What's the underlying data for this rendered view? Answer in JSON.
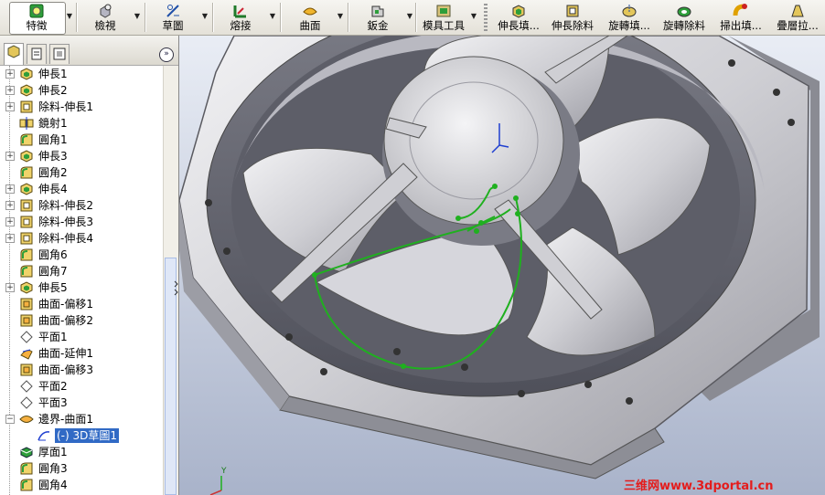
{
  "toolbar": {
    "items": [
      {
        "label": "特徵",
        "icon": "feature-icon"
      },
      {
        "label": "檢視",
        "icon": "view-icon"
      },
      {
        "label": "草圖",
        "icon": "sketch-icon"
      },
      {
        "label": "熔接",
        "icon": "weldment-icon"
      },
      {
        "label": "曲面",
        "icon": "surface-icon"
      },
      {
        "label": "鈑金",
        "icon": "sheet-metal-icon"
      },
      {
        "label": "模具工具",
        "icon": "mold-tools-icon"
      },
      {
        "label": "伸長填...",
        "icon": "extrude-boss-icon"
      },
      {
        "label": "伸長除料",
        "icon": "extrude-cut-icon"
      },
      {
        "label": "旋轉填...",
        "icon": "revolve-boss-icon"
      },
      {
        "label": "旋轉除料",
        "icon": "revolve-cut-icon"
      },
      {
        "label": "掃出填...",
        "icon": "sweep-boss-icon"
      },
      {
        "label": "疊層拉...",
        "icon": "loft-boss-icon"
      }
    ]
  },
  "panel": {
    "expand_symbol": "»",
    "tree": [
      {
        "label": "伸長1",
        "icon": "extrude-feature-icon",
        "expandable": true
      },
      {
        "label": "伸長2",
        "icon": "extrude-feature-icon",
        "expandable": true
      },
      {
        "label": "除料-伸長1",
        "icon": "cut-feature-icon",
        "expandable": true
      },
      {
        "label": "鏡射1",
        "icon": "mirror-feature-icon",
        "expandable": false
      },
      {
        "label": "圓角1",
        "icon": "fillet-feature-icon",
        "expandable": false
      },
      {
        "label": "伸長3",
        "icon": "extrude-feature-icon",
        "expandable": true
      },
      {
        "label": "圓角2",
        "icon": "fillet-feature-icon",
        "expandable": false
      },
      {
        "label": "伸長4",
        "icon": "extrude-feature-icon",
        "expandable": true
      },
      {
        "label": "除料-伸長2",
        "icon": "cut-feature-icon",
        "expandable": true
      },
      {
        "label": "除料-伸長3",
        "icon": "cut-feature-icon",
        "expandable": true
      },
      {
        "label": "除料-伸長4",
        "icon": "cut-feature-icon",
        "expandable": true
      },
      {
        "label": "圓角6",
        "icon": "fillet-feature-icon",
        "expandable": false
      },
      {
        "label": "圓角7",
        "icon": "fillet-feature-icon",
        "expandable": false
      },
      {
        "label": "伸長5",
        "icon": "extrude-feature-icon",
        "expandable": true
      },
      {
        "label": "曲面-偏移1",
        "icon": "offset-surface-icon",
        "expandable": false
      },
      {
        "label": "曲面-偏移2",
        "icon": "offset-surface-icon",
        "expandable": false
      },
      {
        "label": "平面1",
        "icon": "plane-icon",
        "expandable": false
      },
      {
        "label": "曲面-延伸1",
        "icon": "extend-surface-icon",
        "expandable": false
      },
      {
        "label": "曲面-偏移3",
        "icon": "offset-surface-icon",
        "expandable": false
      },
      {
        "label": "平面2",
        "icon": "plane-icon",
        "expandable": false
      },
      {
        "label": "平面3",
        "icon": "plane-icon",
        "expandable": false
      },
      {
        "label": "邊界-曲面1",
        "icon": "boundary-surface-icon",
        "expandable": true,
        "expanded": true
      },
      {
        "label": "(-) 3D草圖1",
        "icon": "3d-sketch-icon",
        "expandable": false,
        "child": true,
        "selected": true
      },
      {
        "label": "厚面1",
        "icon": "thicken-feature-icon",
        "expandable": false
      },
      {
        "label": "圓角3",
        "icon": "fillet-feature-icon",
        "expandable": false
      },
      {
        "label": "圓角4",
        "icon": "fillet-feature-icon",
        "expandable": false
      }
    ]
  },
  "viewport": {
    "watermark": "三维网www.3dportal.cn",
    "axis_label": "Y"
  },
  "colors": {
    "accent_green": "#1fb01f",
    "selection_blue": "#316ac5",
    "watermark_red": "#e41c1c"
  }
}
